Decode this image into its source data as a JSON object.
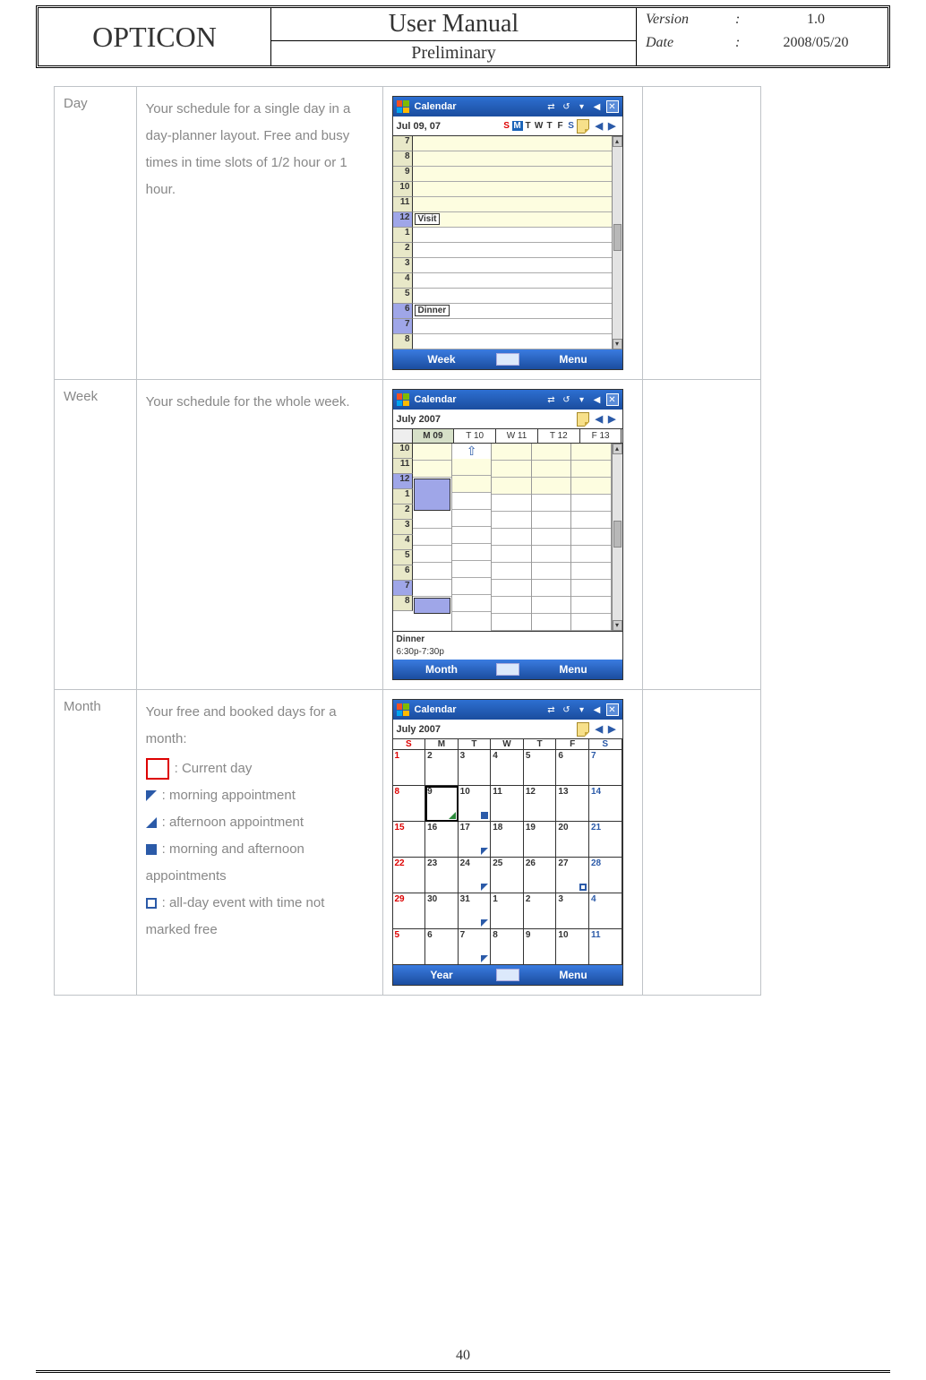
{
  "header": {
    "brand": "OPTICON",
    "title": "User Manual",
    "subtitle": "Preliminary",
    "version_label": "Version",
    "version_value": "1.0",
    "date_label": "Date",
    "date_value": "2008/05/20",
    "colon": ":"
  },
  "page_number": "40",
  "calendar_app_title": "Calendar",
  "rows": {
    "day": {
      "label": "Day",
      "desc": "Your schedule for a single day in a day-planner layout. Free and busy times in time slots of 1/2 hour or 1 hour."
    },
    "week": {
      "label": "Week",
      "desc": "Your schedule for the whole week."
    },
    "month": {
      "label": "Month",
      "desc": "Your free and booked days for a month:",
      "legend": {
        "current": ": Current day",
        "morning": ": morning appointment",
        "afternoon": ": afternoon appointment",
        "both_line1": ": morning and afternoon",
        "both_line2": "appointments",
        "allday_line1": ": all-day event with time not",
        "allday_line2": "marked free"
      }
    }
  },
  "day_shot": {
    "date": "Jul 09, 07",
    "days": [
      "S",
      "M",
      "T",
      "W",
      "T",
      "F",
      "S"
    ],
    "hours": [
      "7",
      "8",
      "9",
      "10",
      "11",
      "12",
      "1",
      "2",
      "3",
      "4",
      "5",
      "6",
      "7",
      "8"
    ],
    "appt1": "Visit",
    "appt2": "Dinner",
    "soft_left": "Week",
    "soft_right": "Menu"
  },
  "week_shot": {
    "date": "July 2007",
    "columns": [
      "M 09",
      "T 10",
      "W 11",
      "T 12",
      "F 13"
    ],
    "hours": [
      "10",
      "11",
      "12",
      "1",
      "2",
      "3",
      "4",
      "5",
      "6",
      "7",
      "8"
    ],
    "footer_title": "Dinner",
    "footer_time": "6:30p-7:30p",
    "soft_left": "Month",
    "soft_right": "Menu"
  },
  "month_shot": {
    "date": "July 2007",
    "day_heads": [
      "S",
      "M",
      "T",
      "W",
      "T",
      "F",
      "S"
    ],
    "weeks": [
      [
        {
          "n": "1",
          "c": "sun"
        },
        {
          "n": "2"
        },
        {
          "n": "3"
        },
        {
          "n": "4"
        },
        {
          "n": "5"
        },
        {
          "n": "6"
        },
        {
          "n": "7",
          "c": "sat"
        }
      ],
      [
        {
          "n": "8",
          "c": "sun"
        },
        {
          "n": "9",
          "sel": true,
          "mark": "morn"
        },
        {
          "n": "10",
          "mark": "both"
        },
        {
          "n": "11"
        },
        {
          "n": "12"
        },
        {
          "n": "13"
        },
        {
          "n": "14",
          "c": "sat"
        }
      ],
      [
        {
          "n": "15",
          "c": "sun"
        },
        {
          "n": "16"
        },
        {
          "n": "17",
          "mark": "tri"
        },
        {
          "n": "18"
        },
        {
          "n": "19"
        },
        {
          "n": "20"
        },
        {
          "n": "21",
          "c": "sat"
        }
      ],
      [
        {
          "n": "22",
          "c": "sun"
        },
        {
          "n": "23"
        },
        {
          "n": "24",
          "mark": "tri"
        },
        {
          "n": "25"
        },
        {
          "n": "26"
        },
        {
          "n": "27",
          "mark": "outline"
        },
        {
          "n": "28",
          "c": "sat"
        }
      ],
      [
        {
          "n": "29",
          "c": "sun"
        },
        {
          "n": "30"
        },
        {
          "n": "31",
          "mark": "tri"
        },
        {
          "n": "1"
        },
        {
          "n": "2"
        },
        {
          "n": "3"
        },
        {
          "n": "4",
          "c": "sat"
        }
      ],
      [
        {
          "n": "5",
          "c": "sun"
        },
        {
          "n": "6"
        },
        {
          "n": "7",
          "mark": "tri"
        },
        {
          "n": "8"
        },
        {
          "n": "9"
        },
        {
          "n": "10"
        },
        {
          "n": "11",
          "c": "sat"
        }
      ]
    ],
    "soft_left": "Year",
    "soft_right": "Menu"
  }
}
